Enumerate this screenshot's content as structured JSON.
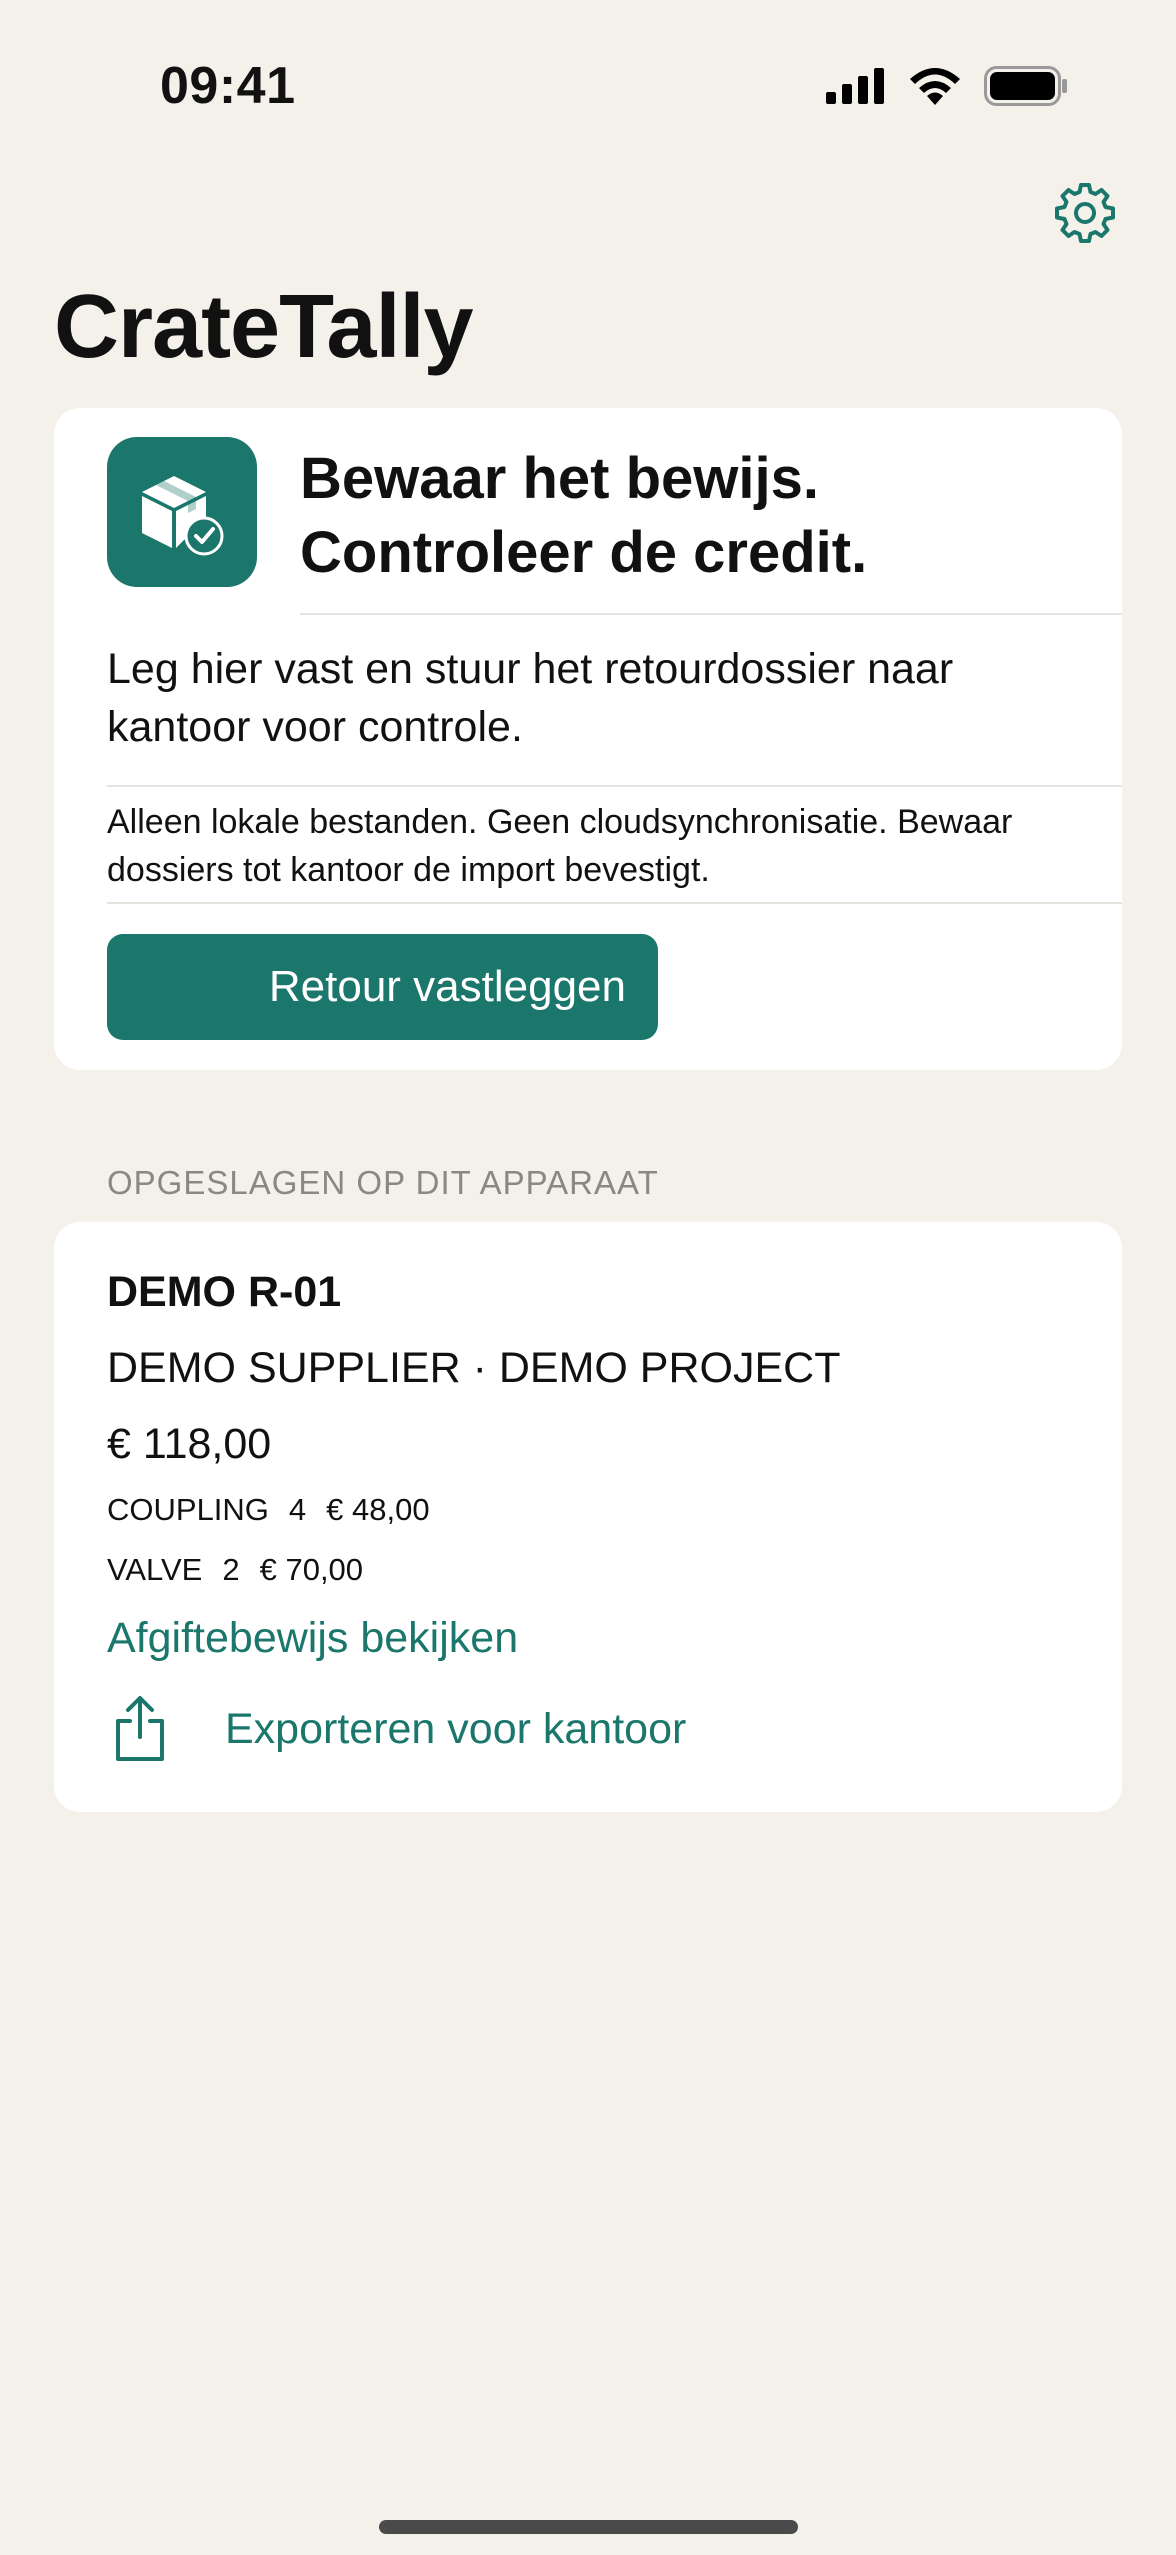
{
  "status": {
    "time": "09:41"
  },
  "header": {
    "title": "CrateTally"
  },
  "hero": {
    "headline_line1": "Bewaar het bewijs.",
    "headline_line2": "Controleer de credit.",
    "lead": "Leg hier vast en stuur het retourdossier naar kantoor voor controle.",
    "fine": "Alleen lokale bestanden. Geen cloudsynchronisatie. Bewaar dossiers tot kantoor de import bevestigt.",
    "button_label": "Retour vastleggen"
  },
  "saved": {
    "section_header": "OPGESLAGEN OP DIT APPARAAT",
    "items": [
      {
        "title": "DEMO R-01",
        "subtitle": "DEMO SUPPLIER · DEMO PROJECT",
        "total": "€ 118,00",
        "lines": [
          {
            "name": "COUPLING",
            "qty": "4",
            "amount": "€ 48,00"
          },
          {
            "name": "VALVE",
            "qty": "2",
            "amount": "€ 70,00"
          }
        ],
        "view_link": "Afgiftebewijs bekijken",
        "export_label": "Exporteren voor kantoor"
      }
    ]
  },
  "colors": {
    "accent": "#1b766b",
    "background": "#f4f1eb",
    "card": "#ffffff"
  },
  "icons": [
    "signal-icon",
    "wifi-icon",
    "battery-icon",
    "gear-icon",
    "package-check-icon",
    "share-icon"
  ]
}
